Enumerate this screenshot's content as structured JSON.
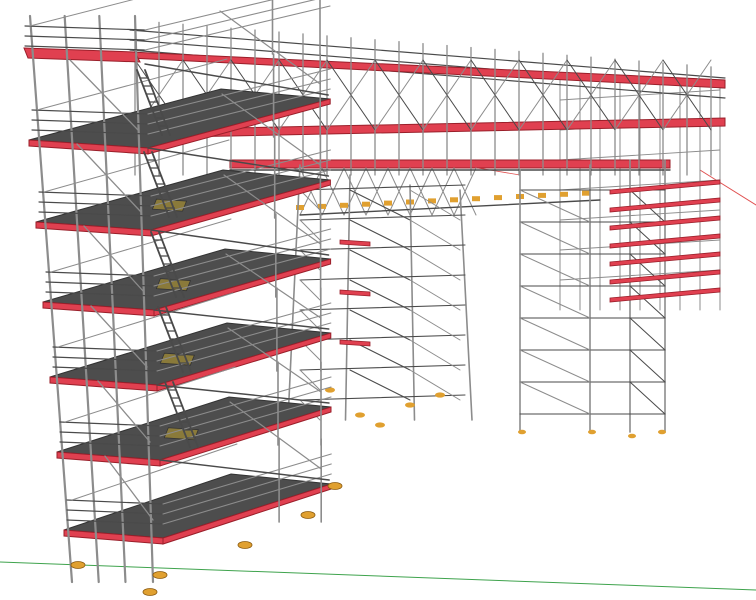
{
  "scene": {
    "subject": "scaffolding-3d-model",
    "colors": {
      "background": "#ffffff",
      "tube": "#8c8c8c",
      "tube_dark": "#4a4a4a",
      "deck": "#e04050",
      "deck_edge": "#9a1f2a",
      "board": "#4d4d4d",
      "board_dark": "#333333",
      "hatch": "#8a7a3a",
      "base_plate": "#e0a030",
      "ground_axis": "#3fa34d",
      "red_axis": "#e05050"
    }
  }
}
